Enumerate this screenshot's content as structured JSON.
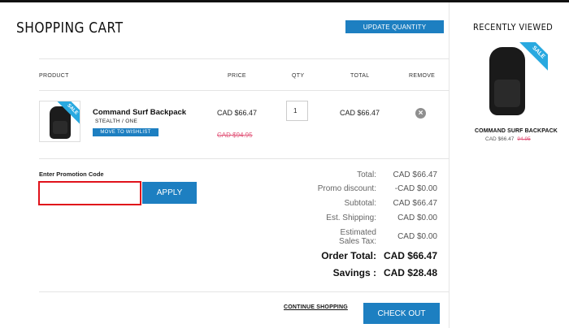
{
  "header": {
    "title": "SHOPPING CART",
    "update_label": "UPDATE QUANTITY"
  },
  "table": {
    "columns": [
      "PRODUCT",
      "PRICE",
      "QTY",
      "TOTAL",
      "REMOVE"
    ],
    "items": [
      {
        "name": "Command Surf Backpack",
        "variant": "STEALTH / ONE",
        "wishlist_label": "MOVE TO WISHLIST",
        "sale_badge": "SALE",
        "price": "CAD $66.47",
        "original_price": "CAD $94.95",
        "qty": "1",
        "total": "CAD $66.47",
        "remove_icon": "close-icon"
      }
    ]
  },
  "promo": {
    "label": "Enter Promotion Code",
    "value": "",
    "placeholder": "",
    "apply_label": "APPLY"
  },
  "summary": {
    "total_label": "Total:",
    "total_value": "CAD $66.47",
    "promo_label": "Promo discount:",
    "promo_value": "-CAD $0.00",
    "subtotal_label": "Subtotal:",
    "subtotal_value": "CAD $66.47",
    "shipping_label": "Est. Shipping:",
    "shipping_value": "CAD $0.00",
    "tax_label_1": "Estimated",
    "tax_label_2": "Sales Tax:",
    "tax_value": "CAD $0.00",
    "order_total_label": "Order Total:",
    "order_total_value": "CAD $66.47",
    "savings_label": "Savings :",
    "savings_value": "CAD $28.48"
  },
  "footer": {
    "continue_label": "CONTINUE SHOPPING",
    "checkout_label": "CHECK OUT"
  },
  "recently_viewed": {
    "title": "RECENTLY VIEWED",
    "sale_badge": "SALE",
    "product_name": "COMMAND SURF BACKPACK",
    "price": "CAD $66.47",
    "original_price": "94.95"
  },
  "colors": {
    "accent": "#1d7fc1",
    "sale_badge": "#29a9e0",
    "strike_price": "#e2567a",
    "promo_error_border": "#e0121b"
  }
}
